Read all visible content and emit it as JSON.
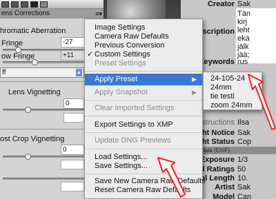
{
  "left_panel": {
    "header": "ens Corrections",
    "header_menu": "≡▾",
    "chromatic_title": "hromatic Aberration",
    "red_fringe_label": "Fringe",
    "red_fringe_value": "-27",
    "blue_fringe_label": "ow Fringe",
    "blue_fringe_value": "+11",
    "defringe_value": "ff",
    "lens_vignetting_title": "Lens Vignetting",
    "lens_vignetting_amount": "0",
    "post_crop_title": "ost Crop Vignetting",
    "post_crop_amount": "0"
  },
  "main_menu": {
    "items": {
      "image_settings": "Image Settings",
      "camera_raw_defaults": "Camera Raw Defaults",
      "previous_conversion": "Previous Conversion",
      "custom_settings": "Custom Settings",
      "preset_settings": "Preset Settings",
      "apply_preset": "Apply Preset",
      "apply_snapshot": "Apply Snapshot",
      "clear_imported": "Clear Imported Settings",
      "export_xmp": "Export Settings to XMP",
      "update_dng": "Update DNG Previews",
      "load_settings": "Load Settings...",
      "save_settings": "Save Settings...",
      "save_new_defaults": "Save New Camera Raw Defaults",
      "reset_defaults": "Reset Camera Raw Defaults"
    },
    "check_mark": "✓",
    "submenu_arrow": "▶"
  },
  "sub_menu": {
    "items": [
      "24-105-24",
      "24mm",
      "tie testi",
      "zoom 24mm"
    ]
  },
  "metadata": {
    "creator_label": "Creator",
    "creator_value": "Sak",
    "desc_label": "Description",
    "desc_lines": [
      "Tän",
      "kirj",
      "leht",
      "eka",
      "jälk",
      "jää;",
      "rus"
    ],
    "keywords_label": "Keywords",
    "instructions_label": "Instructions",
    "instructions_value": "Ilsa",
    "copyright_notice_label": "pyright Notice",
    "copyright_notice_value": "Sak",
    "copyright_status_label": "pyright Status",
    "copyright_status_value": "Cop",
    "camera_section": "amera Data (EXIF)",
    "exposure_label": "Exposure",
    "exposure_value": "1/3",
    "speed_label": "Speed Ratings",
    "speed_value": "50",
    "focal_label": "Focal Length",
    "focal_value": "10.",
    "artist_label": "Artist",
    "artist_value": "Sak",
    "model_label": "Model",
    "model_value": "Can"
  },
  "colors": {
    "highlight": "#3a78d8",
    "arrow": "#ff1a1a"
  }
}
